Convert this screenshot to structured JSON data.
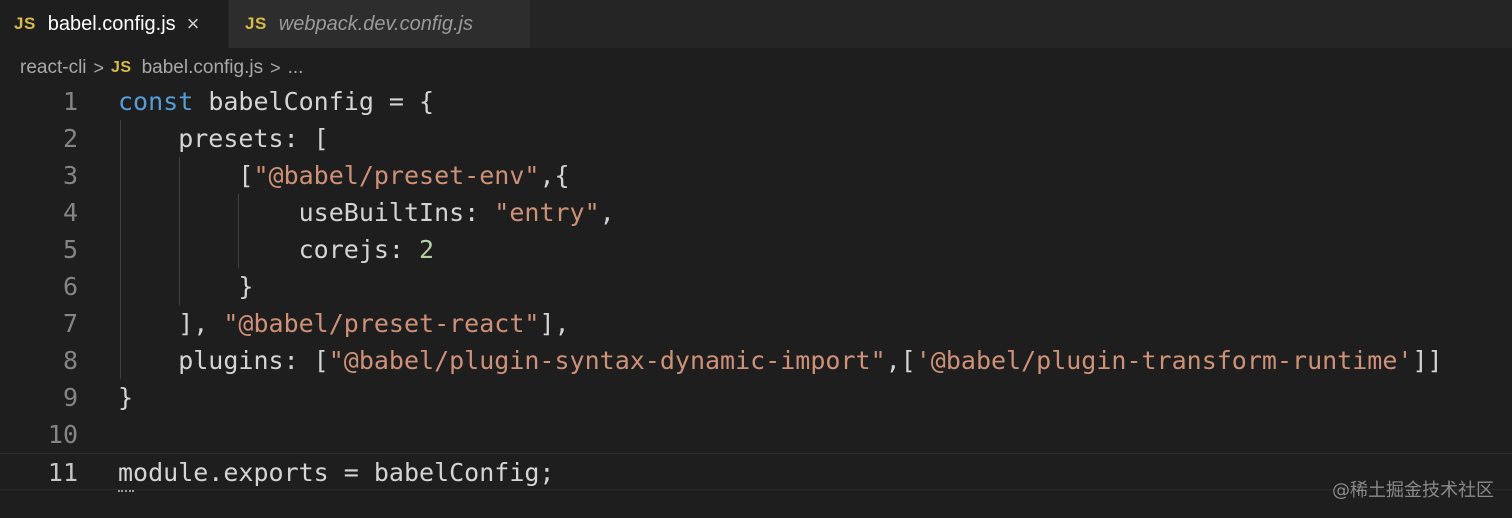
{
  "tabs": [
    {
      "icon": "JS",
      "label": "babel.config.js",
      "close": "×"
    },
    {
      "icon": "JS",
      "label": "webpack.dev.config.js"
    }
  ],
  "breadcrumb": {
    "folder": "react-cli",
    "sep": ">",
    "file_icon": "JS",
    "file": "babel.config.js",
    "ellipsis": "..."
  },
  "editor": {
    "lines": [
      {
        "n": "1",
        "code": "const babelConfig = {"
      },
      {
        "n": "2",
        "code": "    presets: ["
      },
      {
        "n": "3",
        "code": "        [\"@babel/preset-env\",{"
      },
      {
        "n": "4",
        "code": "            useBuiltIns: \"entry\","
      },
      {
        "n": "5",
        "code": "            corejs: 2"
      },
      {
        "n": "6",
        "code": "        }"
      },
      {
        "n": "7",
        "code": "    ], \"@babel/preset-react\"],"
      },
      {
        "n": "8",
        "code": "    plugins: [\"@babel/plugin-syntax-dynamic-import\",['@babel/plugin-transform-runtime']]"
      },
      {
        "n": "9",
        "code": "}"
      },
      {
        "n": "10",
        "code": ""
      },
      {
        "n": "11",
        "code": "module.exports = babelConfig;"
      }
    ],
    "current_line": "11"
  },
  "watermark": "@稀土掘金技术社区",
  "colors": {
    "background": "#1e1e1e",
    "keyword": "#569cd6",
    "string": "#ce9178",
    "number": "#b5cea8",
    "js_icon": "#d7ba4a"
  }
}
